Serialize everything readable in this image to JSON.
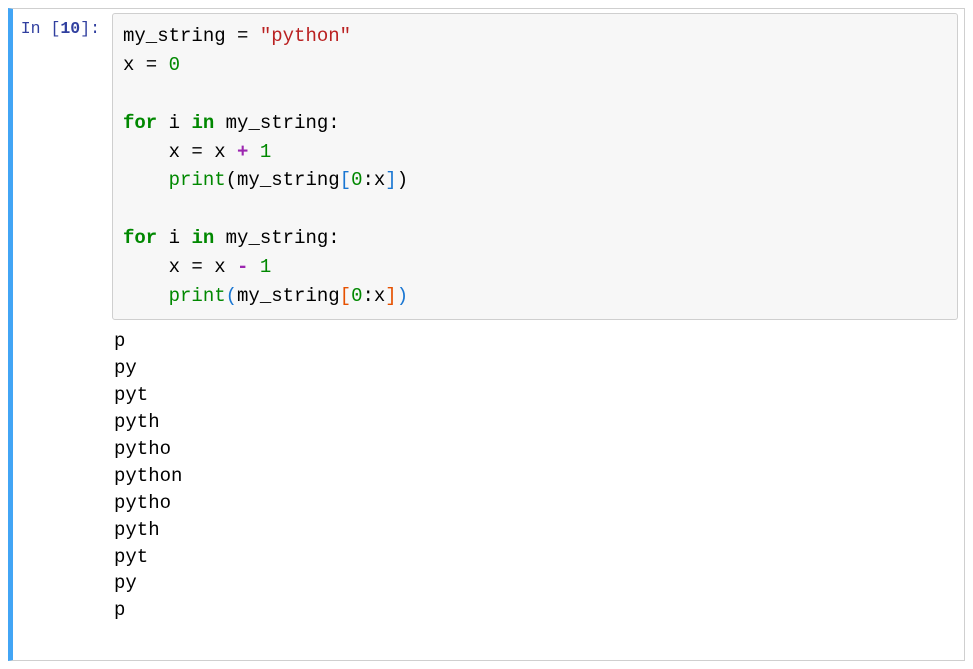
{
  "cell": {
    "prompt_label": "In [",
    "exec_count": "10",
    "prompt_close": "]:",
    "code": {
      "l1_var": "my_string",
      "l1_eq": " = ",
      "l1_str": "\"python\"",
      "l2_var": "x",
      "l2_eq": " = ",
      "l2_num": "0",
      "l4_for": "for",
      "l4_i": " i ",
      "l4_in": "in",
      "l4_ms": " my_string",
      "l4_colon": ":",
      "l5_indent": "    ",
      "l5_x": "x",
      "l5_eq": " = ",
      "l5_x2": "x ",
      "l5_plus": "+",
      "l5_sp": " ",
      "l5_one": "1",
      "l6_indent": "    ",
      "l6_print": "print",
      "l6_lpar": "(",
      "l6_ms": "my_string",
      "l6_lbr": "[",
      "l6_zero": "0",
      "l6_colon": ":",
      "l6_x": "x",
      "l6_rbr": "]",
      "l6_rpar": ")",
      "l8_for": "for",
      "l8_i": " i ",
      "l8_in": "in",
      "l8_ms": " my_string",
      "l8_colon": ":",
      "l9_indent": "    ",
      "l9_x": "x",
      "l9_eq": " = ",
      "l9_x2": "x ",
      "l9_minus": "-",
      "l9_sp": " ",
      "l9_one": "1",
      "l10_indent": "    ",
      "l10_print": "print",
      "l10_lpar": "(",
      "l10_ms": "my_string",
      "l10_lbr": "[",
      "l10_zero": "0",
      "l10_colon": ":",
      "l10_x": "x",
      "l10_rbr": "]",
      "l10_rpar": ")"
    },
    "output": "p\npy\npyt\npyth\npytho\npython\npytho\npyth\npyt\npy\np\n"
  }
}
